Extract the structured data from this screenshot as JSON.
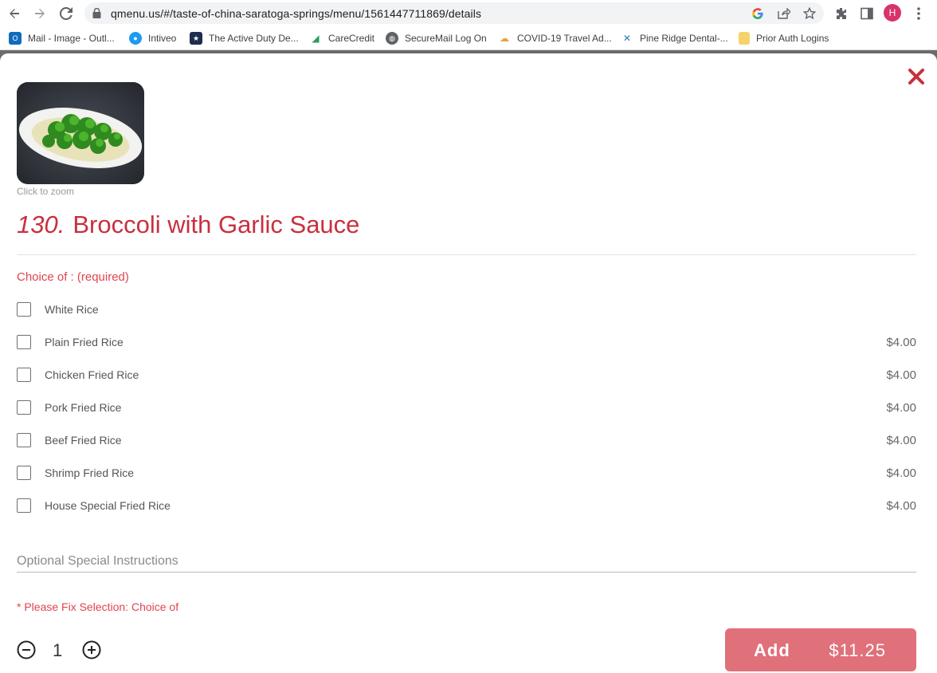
{
  "browser": {
    "url": "qmenu.us/#/taste-of-china-saratoga-springs/menu/1561447711869/details",
    "profile_initial": "H",
    "bookmarks": [
      {
        "label": "Mail - Image - Outl...",
        "icon": "outlook-icon",
        "color": "#0f6cbd"
      },
      {
        "label": "Intiveo",
        "icon": "intiveo-icon",
        "color": "#1e9bf0"
      },
      {
        "label": "The Active Duty De...",
        "icon": "active-duty-icon",
        "color": "#1f2d4d"
      },
      {
        "label": "CareCredit",
        "icon": "carecredit-icon",
        "color": "#2a9d5a"
      },
      {
        "label": "SecureMail Log On",
        "icon": "globe-icon",
        "color": "#5f6368"
      },
      {
        "label": "COVID-19 Travel Ad...",
        "icon": "covid-travel-icon",
        "color": "#e8a33d"
      },
      {
        "label": "Pine Ridge Dental-...",
        "icon": "pine-ridge-icon",
        "color": "#2a7ab8"
      },
      {
        "label": "Prior Auth Logins",
        "icon": "folder-icon",
        "color": "#f5d36a"
      }
    ]
  },
  "item": {
    "zoom_hint": "Click to zoom",
    "number": "130.",
    "name": "Broccoli with Garlic Sauce"
  },
  "choice": {
    "heading": "Choice of : (required)",
    "options": [
      {
        "label": "White Rice",
        "price": ""
      },
      {
        "label": "Plain Fried Rice",
        "price": "$4.00"
      },
      {
        "label": "Chicken Fried Rice",
        "price": "$4.00"
      },
      {
        "label": "Pork Fried Rice",
        "price": "$4.00"
      },
      {
        "label": "Beef Fried Rice",
        "price": "$4.00"
      },
      {
        "label": "Shrimp Fried Rice",
        "price": "$4.00"
      },
      {
        "label": "House Special Fried Rice",
        "price": "$4.00"
      }
    ]
  },
  "instructions": {
    "placeholder": "Optional Special Instructions",
    "value": ""
  },
  "error": "* Please Fix Selection: Choice of",
  "quantity": "1",
  "add": {
    "label": "Add",
    "price": "$11.25"
  },
  "colors": {
    "brand_red": "#c8303f",
    "add_button": "#e0707a",
    "error": "#e0444f"
  }
}
